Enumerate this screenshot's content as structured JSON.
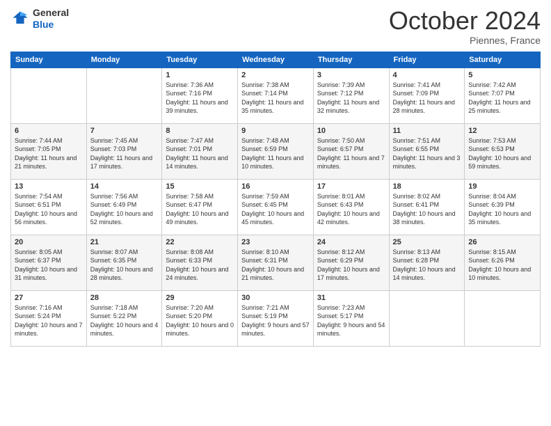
{
  "logo": {
    "general": "General",
    "blue": "Blue"
  },
  "header": {
    "month": "October 2024",
    "location": "Piennes, France"
  },
  "weekdays": [
    "Sunday",
    "Monday",
    "Tuesday",
    "Wednesday",
    "Thursday",
    "Friday",
    "Saturday"
  ],
  "weeks": [
    [
      {
        "day": "",
        "info": ""
      },
      {
        "day": "",
        "info": ""
      },
      {
        "day": "1",
        "info": "Sunrise: 7:36 AM\nSunset: 7:16 PM\nDaylight: 11 hours and 39 minutes."
      },
      {
        "day": "2",
        "info": "Sunrise: 7:38 AM\nSunset: 7:14 PM\nDaylight: 11 hours and 35 minutes."
      },
      {
        "day": "3",
        "info": "Sunrise: 7:39 AM\nSunset: 7:12 PM\nDaylight: 11 hours and 32 minutes."
      },
      {
        "day": "4",
        "info": "Sunrise: 7:41 AM\nSunset: 7:09 PM\nDaylight: 11 hours and 28 minutes."
      },
      {
        "day": "5",
        "info": "Sunrise: 7:42 AM\nSunset: 7:07 PM\nDaylight: 11 hours and 25 minutes."
      }
    ],
    [
      {
        "day": "6",
        "info": "Sunrise: 7:44 AM\nSunset: 7:05 PM\nDaylight: 11 hours and 21 minutes."
      },
      {
        "day": "7",
        "info": "Sunrise: 7:45 AM\nSunset: 7:03 PM\nDaylight: 11 hours and 17 minutes."
      },
      {
        "day": "8",
        "info": "Sunrise: 7:47 AM\nSunset: 7:01 PM\nDaylight: 11 hours and 14 minutes."
      },
      {
        "day": "9",
        "info": "Sunrise: 7:48 AM\nSunset: 6:59 PM\nDaylight: 11 hours and 10 minutes."
      },
      {
        "day": "10",
        "info": "Sunrise: 7:50 AM\nSunset: 6:57 PM\nDaylight: 11 hours and 7 minutes."
      },
      {
        "day": "11",
        "info": "Sunrise: 7:51 AM\nSunset: 6:55 PM\nDaylight: 11 hours and 3 minutes."
      },
      {
        "day": "12",
        "info": "Sunrise: 7:53 AM\nSunset: 6:53 PM\nDaylight: 10 hours and 59 minutes."
      }
    ],
    [
      {
        "day": "13",
        "info": "Sunrise: 7:54 AM\nSunset: 6:51 PM\nDaylight: 10 hours and 56 minutes."
      },
      {
        "day": "14",
        "info": "Sunrise: 7:56 AM\nSunset: 6:49 PM\nDaylight: 10 hours and 52 minutes."
      },
      {
        "day": "15",
        "info": "Sunrise: 7:58 AM\nSunset: 6:47 PM\nDaylight: 10 hours and 49 minutes."
      },
      {
        "day": "16",
        "info": "Sunrise: 7:59 AM\nSunset: 6:45 PM\nDaylight: 10 hours and 45 minutes."
      },
      {
        "day": "17",
        "info": "Sunrise: 8:01 AM\nSunset: 6:43 PM\nDaylight: 10 hours and 42 minutes."
      },
      {
        "day": "18",
        "info": "Sunrise: 8:02 AM\nSunset: 6:41 PM\nDaylight: 10 hours and 38 minutes."
      },
      {
        "day": "19",
        "info": "Sunrise: 8:04 AM\nSunset: 6:39 PM\nDaylight: 10 hours and 35 minutes."
      }
    ],
    [
      {
        "day": "20",
        "info": "Sunrise: 8:05 AM\nSunset: 6:37 PM\nDaylight: 10 hours and 31 minutes."
      },
      {
        "day": "21",
        "info": "Sunrise: 8:07 AM\nSunset: 6:35 PM\nDaylight: 10 hours and 28 minutes."
      },
      {
        "day": "22",
        "info": "Sunrise: 8:08 AM\nSunset: 6:33 PM\nDaylight: 10 hours and 24 minutes."
      },
      {
        "day": "23",
        "info": "Sunrise: 8:10 AM\nSunset: 6:31 PM\nDaylight: 10 hours and 21 minutes."
      },
      {
        "day": "24",
        "info": "Sunrise: 8:12 AM\nSunset: 6:29 PM\nDaylight: 10 hours and 17 minutes."
      },
      {
        "day": "25",
        "info": "Sunrise: 8:13 AM\nSunset: 6:28 PM\nDaylight: 10 hours and 14 minutes."
      },
      {
        "day": "26",
        "info": "Sunrise: 8:15 AM\nSunset: 6:26 PM\nDaylight: 10 hours and 10 minutes."
      }
    ],
    [
      {
        "day": "27",
        "info": "Sunrise: 7:16 AM\nSunset: 5:24 PM\nDaylight: 10 hours and 7 minutes."
      },
      {
        "day": "28",
        "info": "Sunrise: 7:18 AM\nSunset: 5:22 PM\nDaylight: 10 hours and 4 minutes."
      },
      {
        "day": "29",
        "info": "Sunrise: 7:20 AM\nSunset: 5:20 PM\nDaylight: 10 hours and 0 minutes."
      },
      {
        "day": "30",
        "info": "Sunrise: 7:21 AM\nSunset: 5:19 PM\nDaylight: 9 hours and 57 minutes."
      },
      {
        "day": "31",
        "info": "Sunrise: 7:23 AM\nSunset: 5:17 PM\nDaylight: 9 hours and 54 minutes."
      },
      {
        "day": "",
        "info": ""
      },
      {
        "day": "",
        "info": ""
      }
    ]
  ]
}
